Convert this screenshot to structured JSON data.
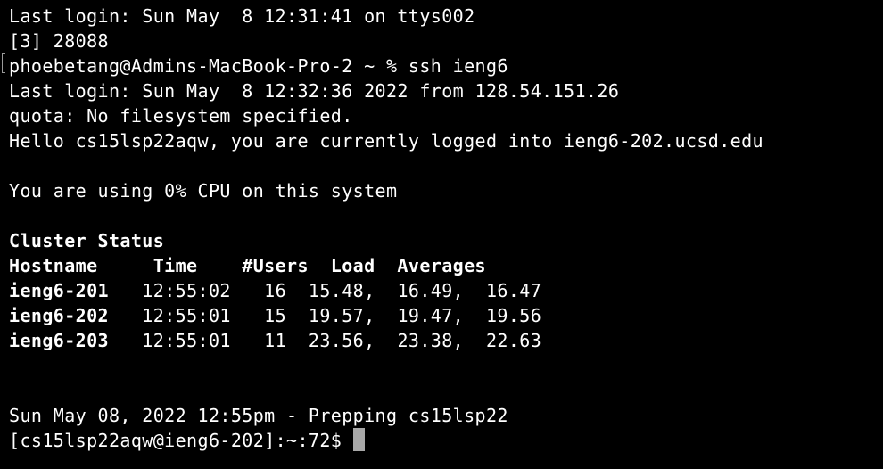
{
  "terminal": {
    "lines": [
      "Last login: Sun May  8 12:31:41 on ttys002",
      "[3] 28088",
      "phoebetang@Admins-MacBook-Pro-2 ~ % ssh ieng6",
      "Last login: Sun May  8 12:32:36 2022 from 128.54.151.26",
      "quota: No filesystem specified.",
      "Hello cs15lsp22aqw, you are currently logged into ieng6-202.ucsd.edu",
      "You are using 0% CPU on this system",
      "Cluster Status",
      "Hostname     Time    #Users  Load  Averages",
      "ieng6-201   12:55:02   16  15.48,  16.49,  16.47",
      "ieng6-202   12:55:01   15  19.57,  19.47,  19.56",
      "ieng6-203   12:55:01   11  23.56,  23.38,  22.63",
      "Sun May 08, 2022 12:55pm - Prepping cs15lsp22",
      "[cs15lsp22aqw@ieng6-202]:~:72$"
    ]
  },
  "colors": {
    "background": "#000000",
    "text": "#ffffff",
    "cursor": "#a8a8a8"
  }
}
